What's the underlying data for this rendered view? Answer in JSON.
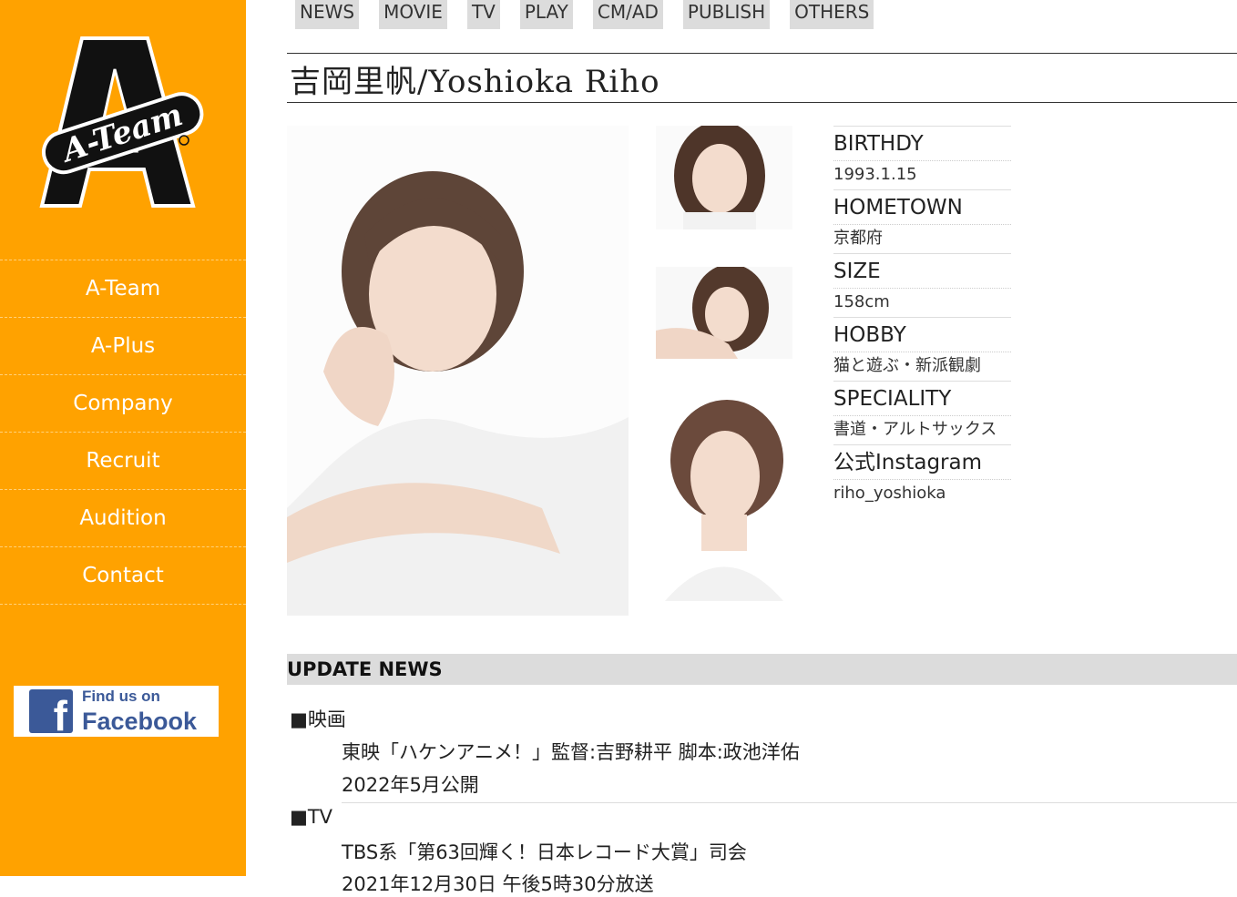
{
  "sidebar": {
    "logo_text": "A-Team",
    "nav": [
      "A-Team",
      "A-Plus",
      "Company",
      "Recruit",
      "Audition",
      "Contact"
    ],
    "facebook": {
      "line1": "Find us on",
      "line2": "Facebook",
      "letter": "f"
    }
  },
  "tabs": [
    "NEWS",
    "MOVIE",
    "TV",
    "PLAY",
    "CM/AD",
    "PUBLISH",
    "OTHERS"
  ],
  "talent_name": "吉岡里帆/Yoshioka Riho",
  "profile": [
    {
      "label": "BIRTHDY",
      "value": "1993.1.15"
    },
    {
      "label": "HOMETOWN",
      "value": "京都府"
    },
    {
      "label": "SIZE",
      "value": "158cm"
    },
    {
      "label": "HOBBY",
      "value": "猫と遊ぶ・新派観劇"
    },
    {
      "label": "SPECIALITY",
      "value": "書道・アルトサックス"
    },
    {
      "label": "公式Instagram",
      "value": "riho_yoshioka"
    }
  ],
  "news": {
    "heading": "UPDATE NEWS",
    "items": [
      {
        "category": "■映画",
        "lines": [
          "東映「ハケンアニメ！」監督:吉野耕平 脚本:政池洋佑",
          "2022年5月公開"
        ]
      },
      {
        "category": "■TV",
        "lines": [
          "TBS系「第63回輝く！日本レコード大賞」司会",
          "2021年12月30日 午後5時30分放送"
        ]
      }
    ]
  },
  "colors": {
    "sidebar": "#ffa200",
    "tab": "#dcdcdc",
    "facebook": "#3b5998"
  }
}
